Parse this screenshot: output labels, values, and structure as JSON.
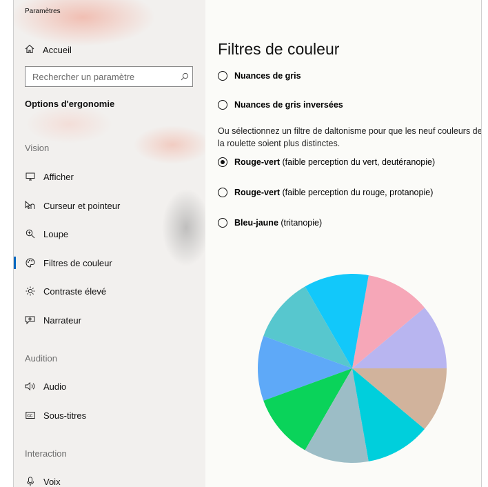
{
  "window": {
    "title": "Paramètres"
  },
  "sidebar": {
    "home_label": "Accueil",
    "search_placeholder": "Rechercher un paramètre",
    "section_title": "Options d'ergonomie",
    "groups": {
      "vision": "Vision",
      "audition": "Audition",
      "interaction": "Interaction"
    },
    "items": [
      {
        "label": "Afficher",
        "icon": "monitor-icon"
      },
      {
        "label": "Curseur et pointeur",
        "icon": "cursor-icon"
      },
      {
        "label": "Loupe",
        "icon": "magnifier-icon"
      },
      {
        "label": "Filtres de couleur",
        "icon": "palette-icon",
        "active": true
      },
      {
        "label": "Contraste élevé",
        "icon": "sun-icon"
      },
      {
        "label": "Narrateur",
        "icon": "narrator-icon"
      },
      {
        "label": "Audio",
        "icon": "speaker-icon"
      },
      {
        "label": "Sous-titres",
        "icon": "captions-icon"
      },
      {
        "label": "Voix",
        "icon": "microphone-icon"
      }
    ]
  },
  "main": {
    "title": "Filtres de couleur",
    "options_top": [
      {
        "label": "Nuances de gris",
        "checked": false
      },
      {
        "label": "Nuances de gris inversées",
        "checked": false
      }
    ],
    "description": "Ou sélectionnez un filtre de daltonisme pour que les neuf couleurs de la roulette soient plus distinctes.",
    "filters": [
      {
        "bold": "Rouge-vert",
        "detail": " (faible perception du vert, deutéranopie)",
        "checked": true
      },
      {
        "bold": "Rouge-vert",
        "detail": " (faible perception du rouge, protanopie)",
        "checked": false
      },
      {
        "bold": "Bleu-jaune",
        "detail": " (tritanopie)",
        "checked": false
      }
    ],
    "wheel_colors": [
      "#b8b5f0",
      "#f6a7b8",
      "#12c8fa",
      "#57c7ce",
      "#5ea9f8",
      "#0ad35a",
      "#9cbdc6",
      "#00cfdc",
      "#d1b39c"
    ]
  }
}
